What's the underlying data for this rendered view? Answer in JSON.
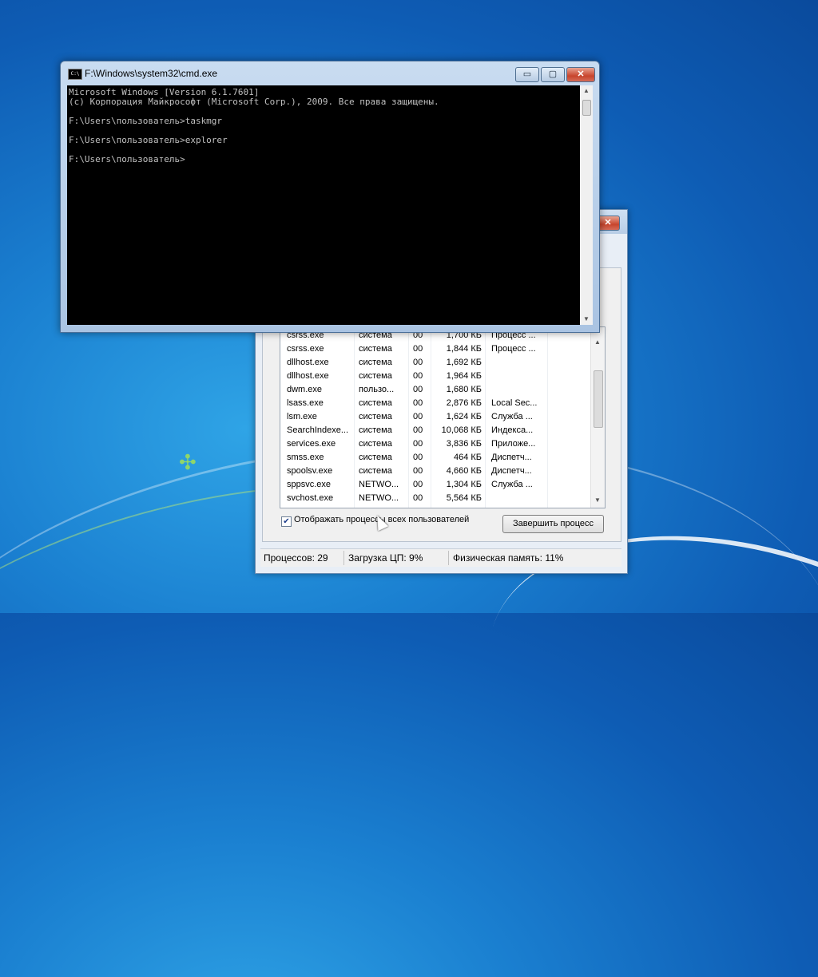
{
  "cmd": {
    "title": "F:\\Windows\\system32\\cmd.exe",
    "icon_text": "C:\\",
    "minimize": "▭",
    "maximize": "▢",
    "close": "✕",
    "lines": [
      "Microsoft Windows [Version 6.1.7601]",
      "(c) Корпорация Майкрософт (Microsoft Corp.), 2009. Все права защищены.",
      "",
      "F:\\Users\\пользователь>taskmgr",
      "",
      "F:\\Users\\пользователь>explorer",
      "",
      "F:\\Users\\пользователь>"
    ]
  },
  "taskmgr": {
    "close": "✕",
    "processes": [
      {
        "name": "csrss.exe",
        "user": "система",
        "cpu": "00",
        "mem": "1,700 КБ",
        "desc": "Процесс ..."
      },
      {
        "name": "csrss.exe",
        "user": "система",
        "cpu": "00",
        "mem": "1,844 КБ",
        "desc": "Процесс ..."
      },
      {
        "name": "dllhost.exe",
        "user": "система",
        "cpu": "00",
        "mem": "1,692 КБ",
        "desc": ""
      },
      {
        "name": "dllhost.exe",
        "user": "система",
        "cpu": "00",
        "mem": "1,964 КБ",
        "desc": ""
      },
      {
        "name": "dwm.exe",
        "user": "пользо...",
        "cpu": "00",
        "mem": "1,680 КБ",
        "desc": ""
      },
      {
        "name": "lsass.exe",
        "user": "система",
        "cpu": "00",
        "mem": "2,876 КБ",
        "desc": "Local Sec..."
      },
      {
        "name": "lsm.exe",
        "user": "система",
        "cpu": "00",
        "mem": "1,624 КБ",
        "desc": "Служба ..."
      },
      {
        "name": "SearchIndexe...",
        "user": "система",
        "cpu": "00",
        "mem": "10,068 КБ",
        "desc": "Индекса..."
      },
      {
        "name": "services.exe",
        "user": "система",
        "cpu": "00",
        "mem": "3,836 КБ",
        "desc": "Приложе..."
      },
      {
        "name": "smss.exe",
        "user": "система",
        "cpu": "00",
        "mem": "464 КБ",
        "desc": "Диспетч..."
      },
      {
        "name": "spoolsv.exe",
        "user": "система",
        "cpu": "00",
        "mem": "4,660 КБ",
        "desc": "Диспетч..."
      },
      {
        "name": "sppsvc.exe",
        "user": "NETWO...",
        "cpu": "00",
        "mem": "1,304 КБ",
        "desc": "Служба ..."
      },
      {
        "name": "svchost.exe",
        "user": "NETWO...",
        "cpu": "00",
        "mem": "5,564 КБ",
        "desc": ""
      }
    ],
    "show_all_users_label": "Отображать процессы всех пользователей",
    "show_all_users_checked": "✔",
    "end_process_label": "Завершить процесс",
    "status": {
      "processes": "Процессов: 29",
      "cpu": "Загрузка ЦП: 9%",
      "memory": "Физическая память: 11%"
    }
  }
}
